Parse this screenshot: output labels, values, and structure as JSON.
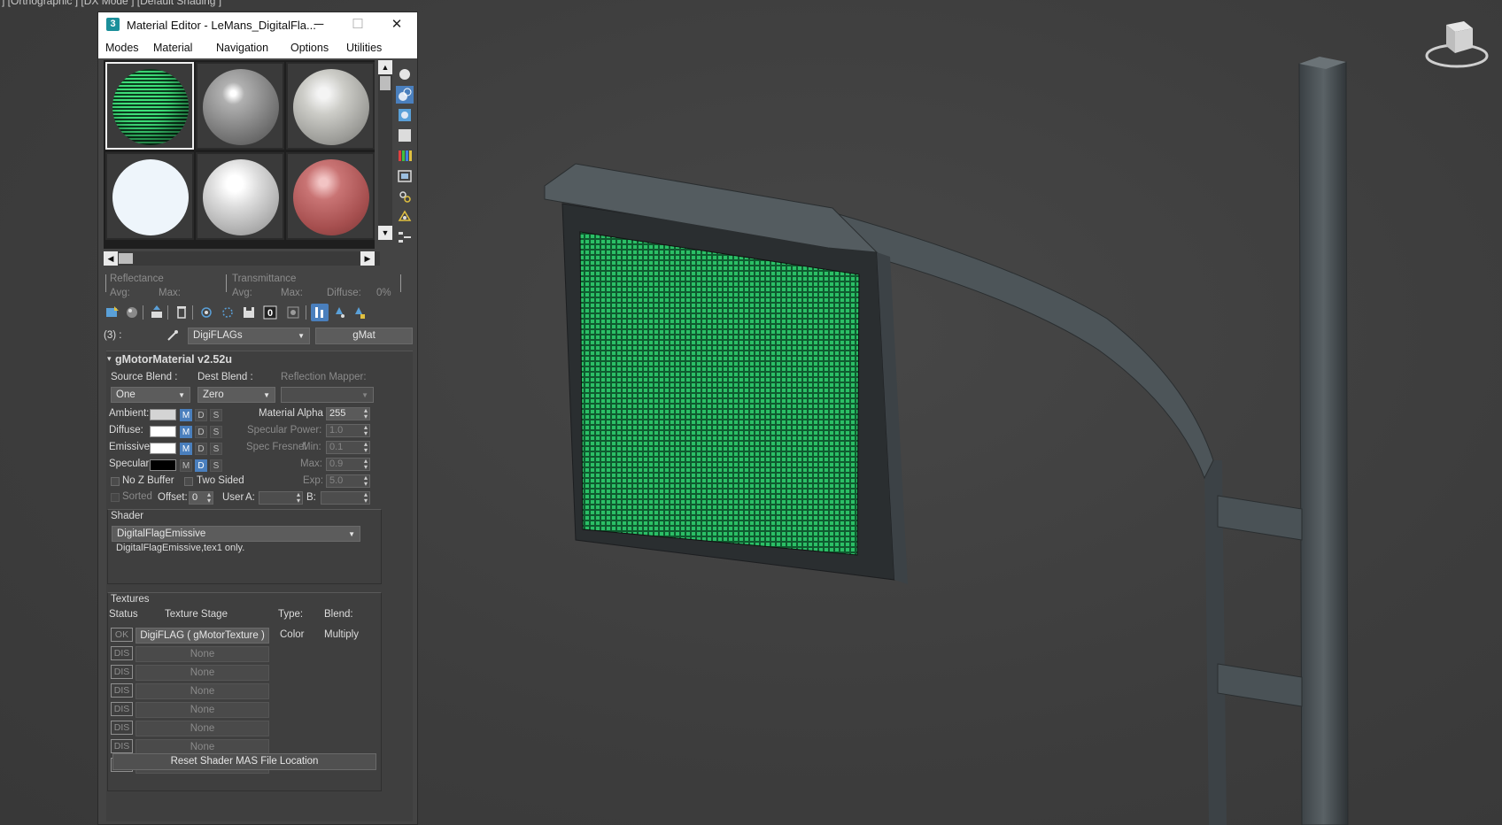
{
  "viewport": {
    "label": "] [Orthographic ] [DX Mode ] [Default Shading ]"
  },
  "editor": {
    "title": "Material Editor - LeMans_DigitalFla...",
    "window_buttons": {
      "minimize": "─",
      "maximize": "☐",
      "close": "✕"
    },
    "menu": [
      "Modes",
      "Material",
      "Navigation",
      "Options",
      "Utilities"
    ],
    "slots": [
      {
        "kind": "digiflag"
      },
      {
        "kind": "gray-glossy"
      },
      {
        "kind": "light-gray"
      },
      {
        "kind": "white-flat"
      },
      {
        "kind": "white-glossy"
      },
      {
        "kind": "red"
      }
    ],
    "reflectance": {
      "reflectance_label": "Reflectance",
      "transmittance_label": "Transmittance",
      "avg_label": "Avg:",
      "max_label": "Max:",
      "t_avg_label": "Avg:",
      "t_max_label": "Max:",
      "diffuse_label": "Diffuse:",
      "diffuse_value": "0%"
    },
    "name_row": {
      "index_label": "(3) :",
      "material_name": "DigiFLAGs",
      "type_button": "gMat"
    },
    "rollout": {
      "title": "gMotorMaterial v2.52u",
      "source_blend_label": "Source Blend :",
      "dest_blend_label": "Dest Blend :",
      "reflection_mapper_label": "Reflection Mapper:",
      "source_blend_value": "One",
      "dest_blend_value": "Zero",
      "reflection_mapper_value": "",
      "colors": [
        {
          "label": "Ambient:",
          "swatch": "#d4d4d4",
          "m_on": true,
          "d_on": false,
          "s_on": false
        },
        {
          "label": "Diffuse:",
          "swatch": "#ffffff",
          "m_on": true,
          "d_on": false,
          "s_on": false
        },
        {
          "label": "Emissive:",
          "swatch": "#ffffff",
          "m_on": true,
          "d_on": false,
          "s_on": false
        },
        {
          "label": "Specular:",
          "swatch": "#000000",
          "m_on": false,
          "d_on": true,
          "s_on": false
        }
      ],
      "mds_letters": {
        "m": "M",
        "d": "D",
        "s": "S"
      },
      "material_alpha_label": "Material Alpha :",
      "material_alpha_value": "255",
      "specular_power_label": "Specular Power:",
      "specular_power_value": "1.0",
      "spec_fresnel_label": "Spec Fresnel",
      "min_label": "Min:",
      "min_value": "0.1",
      "max_label": "Max:",
      "max_value": "0.9",
      "exp_label": "Exp:",
      "exp_value": "5.0",
      "no_z_buffer_label": "No Z Buffer",
      "two_sided_label": "Two Sided",
      "sorted_label": "Sorted",
      "offset_label": "Offset:",
      "offset_value": "0",
      "user_label": "User",
      "a_label": "A:",
      "a_value": "",
      "b_label": "B:",
      "b_value": "",
      "shader_label": "Shader",
      "shader_value": "DigitalFlagEmissive",
      "shader_desc": "DigitalFlagEmissive,tex1 only.",
      "textures_label": "Textures",
      "status_header": "Status",
      "stage_header": "Texture Stage",
      "type_header": "Type:",
      "blend_header": "Blend:",
      "stages": [
        {
          "status": "OK",
          "name": "DigiFLAG  ( gMotorTexture )",
          "type": "Color",
          "blend": "Multiply"
        },
        {
          "status": "DIS",
          "name": "None",
          "type": "",
          "blend": ""
        },
        {
          "status": "DIS",
          "name": "None",
          "type": "",
          "blend": ""
        },
        {
          "status": "DIS",
          "name": "None",
          "type": "",
          "blend": ""
        },
        {
          "status": "DIS",
          "name": "None",
          "type": "",
          "blend": ""
        },
        {
          "status": "DIS",
          "name": "None",
          "type": "",
          "blend": ""
        },
        {
          "status": "DIS",
          "name": "None",
          "type": "",
          "blend": ""
        },
        {
          "status": "DIS",
          "name": "None",
          "type": "",
          "blend": ""
        }
      ],
      "reset_button": "Reset Shader MAS File Location"
    }
  },
  "colors": {
    "accent": "#4a7fbd",
    "led_green": "#1fa85a",
    "viewport_bg": "#3e3e3e"
  }
}
